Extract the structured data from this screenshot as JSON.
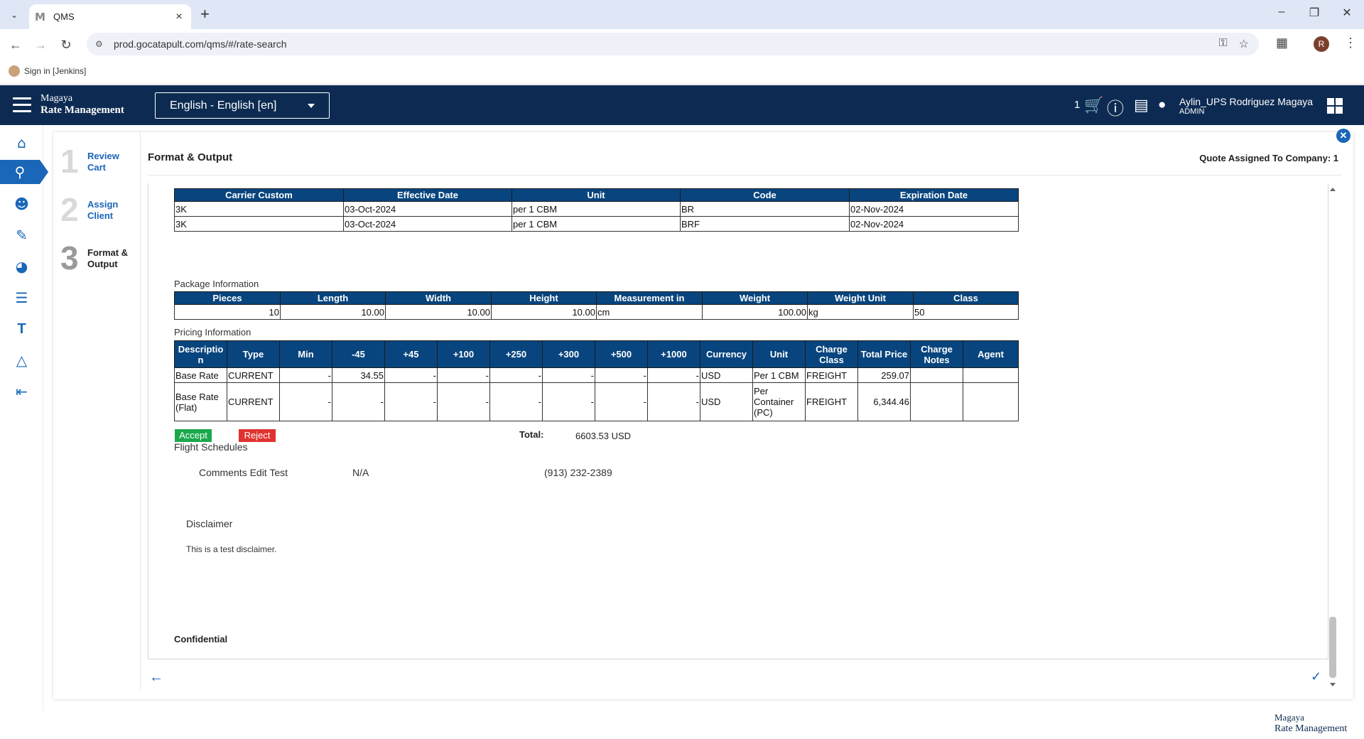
{
  "browser": {
    "tab_title": "QMS",
    "tab_favicon": "M",
    "url": "prod.gocatapult.com/qms/#/rate-search",
    "bookmark": "Sign in [Jenkins]",
    "profile_initial": "R"
  },
  "header": {
    "brand_line1": "Magaya",
    "brand_line2": "Rate Management",
    "language": "English - English [en]",
    "cart_count": "1",
    "user_name": "Aylin_UPS Rodriguez Magaya",
    "user_role": "ADMIN"
  },
  "steps": [
    {
      "num": "1",
      "label_1": "Review",
      "label_2": "Cart"
    },
    {
      "num": "2",
      "label_1": "Assign",
      "label_2": "Client"
    },
    {
      "num": "3",
      "label_1": "Format &",
      "label_2": "Output"
    }
  ],
  "content": {
    "title": "Format & Output",
    "assigned": "Quote Assigned To Company: 1"
  },
  "carrier_table": {
    "headers": [
      "Carrier Custom",
      "Effective Date",
      "Unit",
      "Code",
      "Expiration Date"
    ],
    "rows": [
      [
        "3K",
        "03-Oct-2024",
        "per 1 CBM",
        "BR",
        "02-Nov-2024"
      ],
      [
        "3K",
        "03-Oct-2024",
        "per 1 CBM",
        "BRF",
        "02-Nov-2024"
      ]
    ]
  },
  "package": {
    "section_label": "Package Information",
    "headers": [
      "Pieces",
      "Length",
      "Width",
      "Height",
      "Measurement in",
      "Weight",
      "Weight Unit",
      "Class"
    ],
    "row": [
      "10",
      "10.00",
      "10.00",
      "10.00",
      "cm",
      "100.00",
      "kg",
      "50"
    ]
  },
  "pricing": {
    "section_label": "Pricing Information",
    "headers": [
      "Descriptio n",
      "Type",
      "Min",
      "-45",
      "+45",
      "+100",
      "+250",
      "+300",
      "+500",
      "+1000",
      "Currency",
      "Unit",
      "Charge Class",
      "Total Price",
      "Charge Notes",
      "Agent"
    ],
    "rows": [
      [
        "Base Rate",
        "CURRENT",
        "-",
        "34.55",
        "-",
        "-",
        "-",
        "-",
        "-",
        "-",
        "USD",
        "Per 1 CBM",
        "FREIGHT",
        "259.07",
        "",
        ""
      ],
      [
        "Base Rate (Flat)",
        "CURRENT",
        "-",
        "-",
        "-",
        "-",
        "-",
        "-",
        "-",
        "-",
        "USD",
        "Per Container (PC)",
        "FREIGHT",
        "6,344.46",
        "",
        ""
      ]
    ],
    "accept_label": "Accept",
    "reject_label": "Reject",
    "total_label": "Total:",
    "total_value": "6603.53 USD"
  },
  "flight": {
    "section_label": "Flight Schedules",
    "comments": "Comments Edit Test",
    "na": "N/A",
    "phone": "(913) 232-2389"
  },
  "disclaimer": {
    "title": "Disclaimer",
    "text": "This is a test disclaimer.",
    "confidential": "Confidential"
  },
  "colors": {
    "appbar": "#0d2b52",
    "table_header": "#08457e",
    "accent": "#1a66b8",
    "accept": "#1aa84d",
    "reject": "#e0322f"
  }
}
